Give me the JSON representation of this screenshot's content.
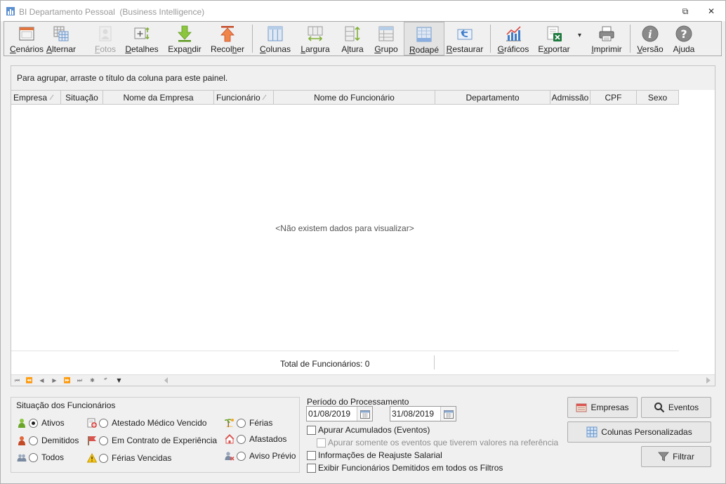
{
  "window": {
    "title": "BI Departamento Pessoal  (Business Intelligence)",
    "restore_glyph": "⧉",
    "close_glyph": "✕"
  },
  "toolbar": {
    "buttons": [
      {
        "label": "Cenários",
        "underline": "C",
        "icon": "scenarios-icon"
      },
      {
        "label": "Alternar",
        "underline": "A",
        "icon": "toggle-grid-icon"
      },
      {
        "label": "Fotos",
        "underline": "F",
        "icon": "photo-icon",
        "disabled": true
      },
      {
        "label": "Detalhes",
        "underline": "D",
        "icon": "details-icon"
      },
      {
        "label": "Expandir",
        "underline": "n",
        "icon": "expand-arrow-icon"
      },
      {
        "label": "Recolher",
        "underline": "h",
        "icon": "collapse-arrow-icon"
      },
      {
        "label": "Colunas",
        "underline": "C",
        "icon": "columns-icon"
      },
      {
        "label": "Largura",
        "underline": "L",
        "icon": "width-icon"
      },
      {
        "label": "Altura",
        "underline": "l",
        "icon": "height-icon"
      },
      {
        "label": "Grupo",
        "underline": "G",
        "icon": "group-icon"
      },
      {
        "label": "Rodapé",
        "underline": "R",
        "icon": "footer-icon",
        "pressed": true
      },
      {
        "label": "Restaurar",
        "underline": "R",
        "icon": "restore-icon"
      },
      {
        "label": "Gráficos",
        "underline": "G",
        "icon": "chart-icon"
      },
      {
        "label": "Exportar",
        "underline": "x",
        "icon": "excel-export-icon"
      },
      {
        "label": "Imprimir",
        "underline": "I",
        "icon": "printer-icon"
      },
      {
        "label": "Versão",
        "underline": "V",
        "icon": "info-icon"
      },
      {
        "label": "Ajuda",
        "underline": "j",
        "icon": "help-icon"
      }
    ]
  },
  "grid": {
    "group_panel_text": "Para agrupar, arraste o título da coluna para este painel.",
    "columns": [
      "Empresa",
      "Situação",
      "Nome da Empresa",
      "Funcionário",
      "Nome do Funcionário",
      "Departamento",
      "Admissão",
      "CPF",
      "Sexo"
    ],
    "empty_message": "<Não existem dados para visualizar>",
    "footer_total": "Total de Funcionários: 0",
    "nav_glyphs": [
      "⏮",
      "⏪",
      "◀",
      "▶",
      "⏩",
      "⏭",
      "✱",
      "*⃰",
      "▼"
    ]
  },
  "situacao": {
    "title": "Situação dos Funcionários",
    "options": [
      {
        "label": "Ativos",
        "icon": "person-green-icon",
        "checked": true
      },
      {
        "label": "Demitidos",
        "icon": "person-red-icon",
        "checked": false
      },
      {
        "label": "Todos",
        "icon": "people-icon",
        "checked": false
      },
      {
        "label": "Atestado Médico Vencido",
        "icon": "medical-certificate-icon",
        "checked": false
      },
      {
        "label": "Em Contrato de Experiência",
        "icon": "flag-icon",
        "checked": false
      },
      {
        "label": "Férias Vencidas",
        "icon": "warning-icon",
        "checked": false
      },
      {
        "label": "Férias",
        "icon": "beach-icon",
        "checked": false
      },
      {
        "label": "Afastados",
        "icon": "house-icon",
        "checked": false
      },
      {
        "label": "Aviso Prévio",
        "icon": "person-x-icon",
        "checked": false
      }
    ]
  },
  "periodo": {
    "title": "Período do Processamento",
    "start": "01/08/2019",
    "end": "31/08/2019"
  },
  "checks": {
    "apurar": "Apurar Acumulados (Eventos)",
    "apurar_somente": "Apurar somente os eventos que tiverem valores na referência",
    "reajuste": "Informações de Reajuste Salarial",
    "exibir": "Exibir Funcionários Demitidos em todos os Filtros"
  },
  "buttons": {
    "empresas": "Empresas",
    "eventos": "Eventos",
    "colunas": "Colunas Personalizadas",
    "filtrar": "Filtrar"
  },
  "colors": {
    "accent_orange": "#e2683a",
    "green": "#7fb034",
    "blue": "#3d7cc9"
  }
}
